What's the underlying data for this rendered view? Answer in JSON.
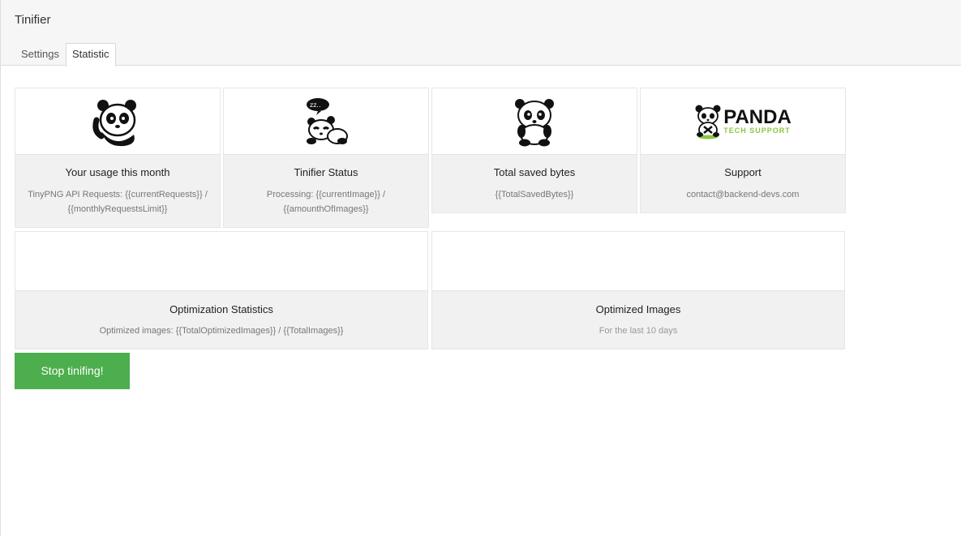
{
  "app": {
    "title": "Tinifier"
  },
  "tabs": [
    {
      "label": "Settings"
    },
    {
      "label": "Statistic"
    }
  ],
  "cards": {
    "usage": {
      "icon": "waving-panda-icon",
      "title": "Your usage this month",
      "text": "TinyPNG API Requests: {{currentRequests}} / {{monthlyRequestsLimit}}"
    },
    "status": {
      "icon": "sleeping-panda-icon",
      "title": "Tinifier Status",
      "text": "Processing: {{currentImage}} / {{amounthOfImages}}"
    },
    "saved": {
      "icon": "sitting-panda-icon",
      "title": "Total saved bytes",
      "text": "{{TotalSavedBytes}}"
    },
    "support": {
      "icon": "panda-tech-support-logo",
      "logo_text": "PANDA",
      "logo_sub": "TECH SUPPORT",
      "title": "Support",
      "text": "contact@backend-devs.com"
    },
    "optimization": {
      "title": "Optimization Statistics",
      "text": "Optimized images: {{TotalOptimizedImages}} / {{TotalImages}}"
    },
    "optimized_images": {
      "title": "Optimized Images",
      "text": "For the last 10 days"
    }
  },
  "actions": {
    "stop_label": "Stop tinifing!"
  },
  "colors": {
    "accent_green": "#4cae4c",
    "logo_green": "#8cc63f"
  }
}
